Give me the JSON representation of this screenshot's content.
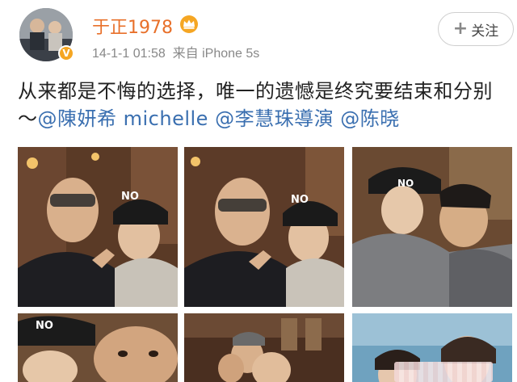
{
  "header": {
    "username": "于正1978",
    "timestamp": "14-1-1 01:58",
    "source_prefix": "来自",
    "device": "iPhone 5s",
    "follow_label": "关注",
    "follow_icon": "plus-icon",
    "avatar_badge_icon": "verified-v-icon",
    "crown_icon": "crown-icon",
    "username_color": "#e8702a"
  },
  "post": {
    "text": "从来都是不悔的选择，唯一的遗憾是终究要结束和分别～",
    "mentions": [
      "@陳妍希 michelle",
      "@李慧珠導演",
      "@陈晓"
    ],
    "mention_color": "#3a6fb0"
  },
  "photos": {
    "cap_text_1": "NO",
    "cap_text_2": "NO",
    "cap_text_3": "NO",
    "cap_text_4": "NO"
  }
}
